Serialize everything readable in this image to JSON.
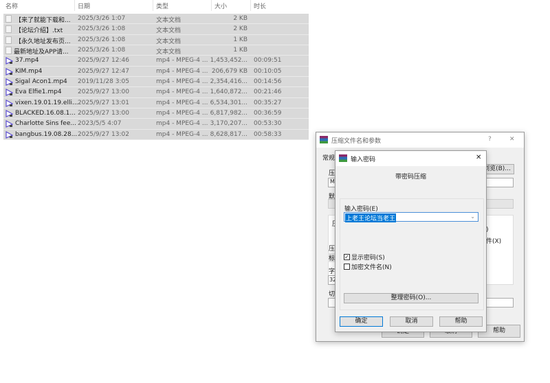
{
  "columns": {
    "name": "名称",
    "date": "日期",
    "type": "类型",
    "size": "大小",
    "duration": "时长"
  },
  "files": [
    {
      "name": "【来了就能下载和...",
      "date": "2025/3/26 1:07",
      "type": "文本文档",
      "size": "2 KB",
      "duration": "",
      "icon": "text-file-icon"
    },
    {
      "name": "【论坛介绍】.txt",
      "date": "2025/3/26 1:08",
      "type": "文本文档",
      "size": "2 KB",
      "duration": "",
      "icon": "text-file-icon"
    },
    {
      "name": "【永久地址发布页...",
      "date": "2025/3/26 1:08",
      "type": "文本文档",
      "size": "1 KB",
      "duration": "",
      "icon": "text-file-icon"
    },
    {
      "name": "最新地址及APP请...",
      "date": "2025/3/26 1:08",
      "type": "文本文档",
      "size": "1 KB",
      "duration": "",
      "icon": "text-file-icon"
    },
    {
      "name": "37.mp4",
      "date": "2025/9/27 12:46",
      "type": "mp4 - MPEG-4 ...",
      "size": "1,453,452...",
      "duration": "00:09:51",
      "icon": "video-file-icon"
    },
    {
      "name": "KIM.mp4",
      "date": "2025/9/27 12:47",
      "type": "mp4 - MPEG-4 ...",
      "size": "206,679 KB",
      "duration": "00:10:05",
      "icon": "video-file-icon"
    },
    {
      "name": "Sigal Acon1.mp4",
      "date": "2019/11/28 3:05",
      "type": "mp4 - MPEG-4 ...",
      "size": "2,354,416...",
      "duration": "00:14:56",
      "icon": "video-file-icon"
    },
    {
      "name": "Eva Elfie1.mp4",
      "date": "2025/9/27 13:00",
      "type": "mp4 - MPEG-4 ...",
      "size": "1,640,872...",
      "duration": "00:21:46",
      "icon": "video-file-icon"
    },
    {
      "name": "vixen.19.01.19.elli...",
      "date": "2025/9/27 13:01",
      "type": "mp4 - MPEG-4 ...",
      "size": "6,534,301...",
      "duration": "00:35:27",
      "icon": "video-file-icon"
    },
    {
      "name": "BLACKED.16.08.1...",
      "date": "2025/9/27 13:00",
      "type": "mp4 - MPEG-4 ...",
      "size": "6,817,982...",
      "duration": "00:36:59",
      "icon": "video-file-icon"
    },
    {
      "name": "Charlotte Sins fee...",
      "date": "2023/5/5 4:07",
      "type": "mp4 - MPEG-4 ...",
      "size": "3,170,207...",
      "duration": "00:53:30",
      "icon": "video-file-icon"
    },
    {
      "name": "bangbus.19.08.28...",
      "date": "2025/9/27 13:02",
      "type": "mp4 - MPEG-4 ...",
      "size": "8,628,817...",
      "duration": "00:58:33",
      "icon": "video-file-icon"
    }
  ],
  "archive_dialog": {
    "title": "压缩文件名和参数",
    "help": "?",
    "close": "✕",
    "tab": "常规",
    "browse": "浏览(B)...",
    "frag1": "压",
    "frag2": "ME",
    "frag3": "默",
    "frag4": "压",
    "frag5": "压",
    "frag6": "标",
    "frag7": "字",
    "frag8": "32",
    "frag9": "切",
    "frag10": ")",
    "frag11": "件(X)",
    "ok": "确定",
    "cancel": "取消",
    "helpbtn": "帮助"
  },
  "password_dialog": {
    "title": "输入密码",
    "close": "✕",
    "heading": "带密码压缩",
    "label": "输入密码(E)",
    "value": "上老王论坛当老王",
    "show_password": "显示密码(S)",
    "show_password_checked": true,
    "encrypt_names": "加密文件名(N)",
    "encrypt_names_checked": false,
    "organize": "整理密码(O)...",
    "ok": "确定",
    "cancel": "取消",
    "help": "帮助"
  }
}
